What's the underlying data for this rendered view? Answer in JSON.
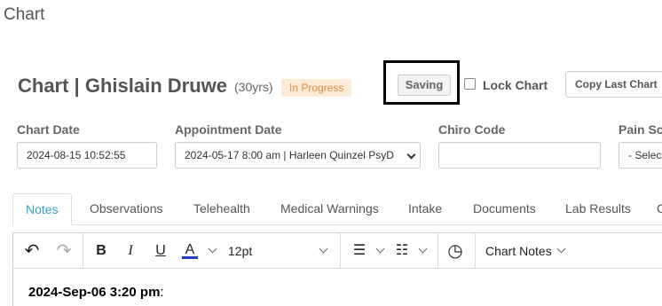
{
  "page": {
    "heading": "Chart"
  },
  "header": {
    "title": "Chart | Ghislain Druwe",
    "age": "(30yrs)",
    "status": "In Progress",
    "saving_label": "Saving",
    "lock_label": "Lock Chart",
    "copy_label": "Copy Last Chart"
  },
  "fields": {
    "chart_date": {
      "label": "Chart Date",
      "value": "2024-08-15 10:52:55"
    },
    "appointment_date": {
      "label": "Appointment Date",
      "value": "2024-05-17 8:00 am | Harleen Quinzel PsyD"
    },
    "chiro_code": {
      "label": "Chiro Code",
      "value": ""
    },
    "pain_scale": {
      "label": "Pain Sca",
      "value": "- Selec"
    }
  },
  "tabs": [
    {
      "label": "Notes"
    },
    {
      "label": "Observations"
    },
    {
      "label": "Telehealth"
    },
    {
      "label": "Medical Warnings"
    },
    {
      "label": "Intake"
    },
    {
      "label": "Documents"
    },
    {
      "label": "Lab Results"
    },
    {
      "label": "C"
    }
  ],
  "toolbar": {
    "font_size": "12pt",
    "template_label": "Chart Notes",
    "undo_icon": "↶",
    "redo_icon": "↷",
    "bold_icon": "B",
    "italic_icon": "I",
    "underline_icon": "U",
    "color_icon": "A",
    "bullet_icon": "☰",
    "number_icon": "☷",
    "clock_icon": "◷"
  },
  "editor": {
    "timestamp": "2024-Sep-06 3:20 pm",
    "suffix": ":"
  },
  "colors": {
    "accent": "#3aa0c8",
    "status_text": "#e08a3a",
    "status_bg": "#fdebd8",
    "font_color_underline": "#1f3fbf"
  }
}
